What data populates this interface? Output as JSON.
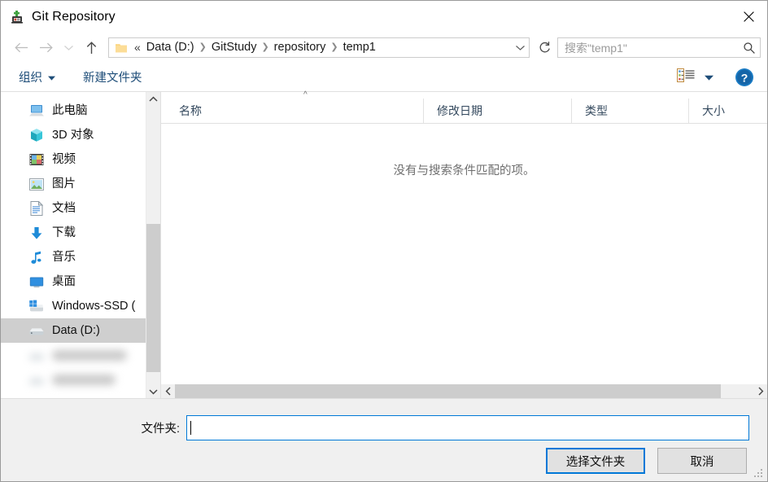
{
  "window": {
    "title": "Git Repository",
    "app_icon": "git-repository-icon",
    "close_label": "✕"
  },
  "nav": {
    "back_icon": "arrow-left-icon",
    "forward_icon": "arrow-right-icon",
    "recent_icon": "chevron-down-icon",
    "up_icon": "arrow-up-icon",
    "refresh_icon": "refresh-icon",
    "folder_icon": "folder-icon",
    "dropdown_icon": "chevron-down-icon"
  },
  "address": {
    "ellipsis": "«",
    "crumbs": [
      "Data (D:)",
      "GitStudy",
      "repository",
      "temp1"
    ],
    "separator": "❯"
  },
  "search": {
    "placeholder": "搜索\"temp1\"",
    "icon": "search-icon"
  },
  "toolbar": {
    "organize_label": "组织",
    "organize_arrow": "▼",
    "new_folder_label": "新建文件夹",
    "view_icon": "list-view-icon",
    "view_arrow": "▼",
    "help_label": "?",
    "help_icon": "help-icon"
  },
  "sidebar": {
    "items": [
      {
        "label": "此电脑",
        "icon": "this-pc-icon",
        "selected": false
      },
      {
        "label": "3D 对象",
        "icon": "3d-objects-icon",
        "selected": false
      },
      {
        "label": "视频",
        "icon": "videos-icon",
        "selected": false
      },
      {
        "label": "图片",
        "icon": "pictures-icon",
        "selected": false
      },
      {
        "label": "文档",
        "icon": "documents-icon",
        "selected": false
      },
      {
        "label": "下载",
        "icon": "downloads-icon",
        "selected": false
      },
      {
        "label": "音乐",
        "icon": "music-icon",
        "selected": false
      },
      {
        "label": "桌面",
        "icon": "desktop-icon",
        "selected": false
      },
      {
        "label": "Windows-SSD (",
        "icon": "windows-drive-icon",
        "selected": false
      },
      {
        "label": "Data (D:)",
        "icon": "drive-icon",
        "selected": true
      }
    ],
    "scrollbar": {
      "up_arrow": "chevron-up-icon",
      "down_arrow": "chevron-down-icon"
    }
  },
  "filelist": {
    "columns": [
      {
        "label": "名称",
        "sorted": "asc",
        "sort_caret": "^"
      },
      {
        "label": "修改日期",
        "sorted": ""
      },
      {
        "label": "类型",
        "sorted": ""
      },
      {
        "label": "大小",
        "sorted": ""
      }
    ],
    "empty_message": "没有与搜索条件匹配的项。",
    "rows": [],
    "hscrollbar": {
      "left_arrow": "❮",
      "right_arrow": "❯"
    }
  },
  "footer": {
    "folder_label": "文件夹:",
    "folder_value": "",
    "folder_placeholder": "",
    "select_button": "选择文件夹",
    "cancel_button": "取消"
  },
  "colors": {
    "accent": "#0078d7",
    "toolbar_link": "#1f4e79",
    "selection": "#cfcfcf",
    "footer_bg": "#f0f0f0"
  }
}
